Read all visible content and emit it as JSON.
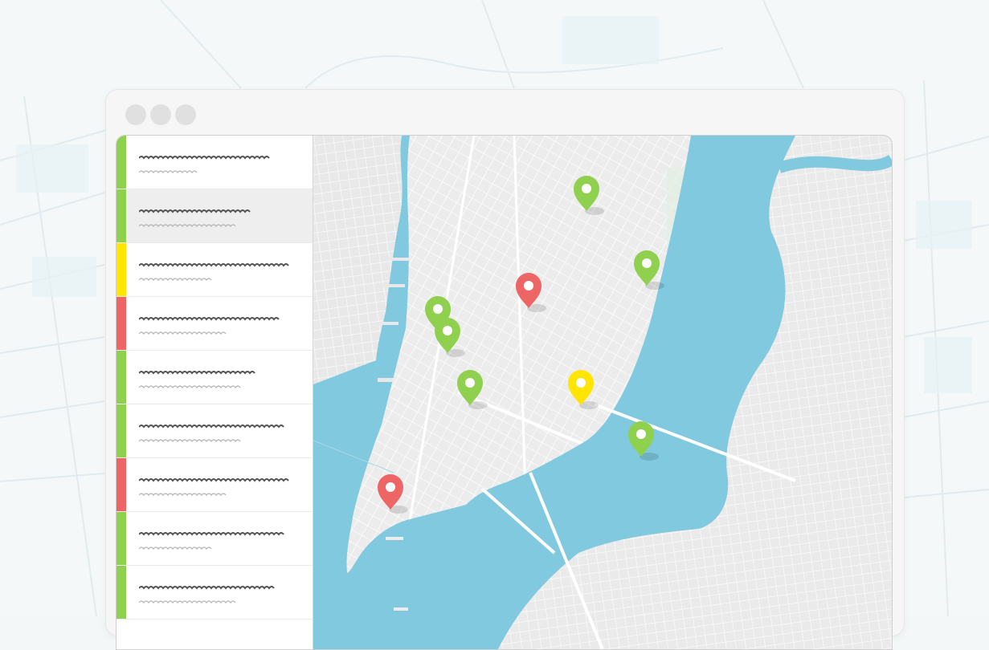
{
  "window": {
    "controls": [
      "close",
      "minimize",
      "maximize"
    ]
  },
  "colors": {
    "green": "#8fd14f",
    "yellow": "#ffe500",
    "red": "#ee6565",
    "water": "#80c9df",
    "land": "#eaeaea"
  },
  "sidebar": {
    "items": [
      {
        "status": "green",
        "selected": false
      },
      {
        "status": "green",
        "selected": true
      },
      {
        "status": "yellow",
        "selected": false
      },
      {
        "status": "red",
        "selected": false
      },
      {
        "status": "green",
        "selected": false
      },
      {
        "status": "green",
        "selected": false
      },
      {
        "status": "red",
        "selected": false
      },
      {
        "status": "green",
        "selected": false
      },
      {
        "status": "green",
        "selected": false
      }
    ]
  },
  "map": {
    "pins": [
      {
        "status": "green",
        "icon": "map-pin-icon"
      },
      {
        "status": "green",
        "icon": "map-pin-icon"
      },
      {
        "status": "red",
        "icon": "map-pin-icon"
      },
      {
        "status": "green",
        "icon": "map-pin-icon"
      },
      {
        "status": "green",
        "icon": "map-pin-icon"
      },
      {
        "status": "green",
        "icon": "map-pin-icon"
      },
      {
        "status": "yellow",
        "icon": "map-pin-icon"
      },
      {
        "status": "green",
        "icon": "map-pin-icon"
      },
      {
        "status": "red",
        "icon": "map-pin-icon"
      }
    ]
  }
}
